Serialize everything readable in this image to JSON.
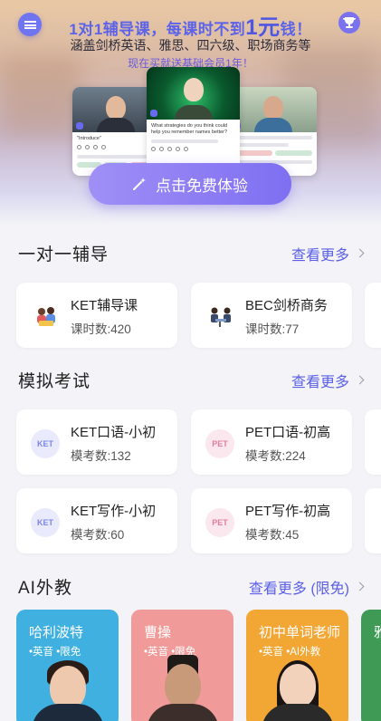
{
  "hero": {
    "title_prefix": "1对1辅导课，每课时不到",
    "title_highlight": "1元",
    "title_suffix": "钱！",
    "subtitle": "涵盖剑桥英语、雅思、四六级、职场商务等",
    "promo": "现在买就送基础会员1年！",
    "mock_mid_text": "What strategies do you think could help you remember names better?",
    "mock_left_text": "\"Introduce\"",
    "cta_label": "点击免费体验",
    "left_icon": "menu-chat-icon",
    "right_icon": "trophy-icon"
  },
  "tutoring": {
    "title": "一对一辅导",
    "more": "查看更多",
    "items": [
      {
        "title": "KET辅导课",
        "sub": "课时数:420",
        "icon": "reading-kids-icon"
      },
      {
        "title": "BEC剑桥商务",
        "sub": "课时数:77",
        "icon": "business-meeting-icon"
      }
    ]
  },
  "exams": {
    "title": "模拟考试",
    "more": "查看更多",
    "items": [
      {
        "badge": "KET",
        "title": "KET口语-小初",
        "sub": "模考数:132"
      },
      {
        "badge": "PET",
        "title": "PET口语-初高",
        "sub": "模考数:224"
      },
      {
        "badge": "KET",
        "title": "KET写作-小初",
        "sub": "模考数:60"
      },
      {
        "badge": "PET",
        "title": "PET写作-初高",
        "sub": "模考数:45"
      }
    ]
  },
  "ai_teachers": {
    "title": "AI外教",
    "more": "查看更多 (限免)",
    "items": [
      {
        "name": "哈利波特",
        "tags": "•英音 •限免",
        "color": "#3fb0e0"
      },
      {
        "name": "曹操",
        "tags": "•英音 •限免",
        "color": "#f19a9a"
      },
      {
        "name": "初中单词老师",
        "tags": "•英音 •AI外教",
        "color": "#f2a634"
      },
      {
        "name": "雅",
        "tags": "",
        "color": "#3f9a56"
      }
    ]
  }
}
